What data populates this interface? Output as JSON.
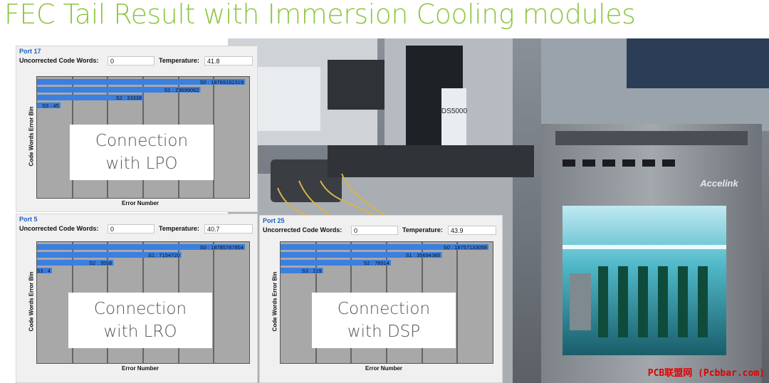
{
  "slide": {
    "title": "FEC Tail Result with Immersion Cooling modules"
  },
  "watermark": "PCB联盟网 (Pcbbar.com)",
  "photo": {
    "brand_text": "Accelink",
    "product_card_text": "DS5000"
  },
  "labels": {
    "uncorrected": "Uncorrected Code Words:",
    "temperature": "Temperature:",
    "y_axis": "Code Words Error Bin",
    "x_axis": "Error Number"
  },
  "panels": [
    {
      "port": "Port 17",
      "uncorrected_value": "0",
      "temperature_value": "41.8",
      "overlay_line1": "Connection",
      "overlay_line2": "with LPO",
      "bars": [
        {
          "label": "S0 : 18769192319",
          "frac": 0.98
        },
        {
          "label": "S1 : 23699062",
          "frac": 0.77
        },
        {
          "label": "S2 : 33338",
          "frac": 0.5
        },
        {
          "label": "S3 : 45",
          "frac": 0.11
        }
      ]
    },
    {
      "port": "Port 5",
      "uncorrected_value": "0",
      "temperature_value": "40.7",
      "overlay_line1": "Connection",
      "overlay_line2": "with LRO",
      "bars": [
        {
          "label": "S0 : 18785787854",
          "frac": 0.98
        },
        {
          "label": "S1 : 7154720",
          "frac": 0.68
        },
        {
          "label": "S2 : 3558",
          "frac": 0.36
        },
        {
          "label": "S3 : 4",
          "frac": 0.07
        }
      ]
    },
    {
      "port": "Port 25",
      "uncorrected_value": "0",
      "temperature_value": "43.9",
      "overlay_line1": "Connection",
      "overlay_line2": "with DSP",
      "bars": [
        {
          "label": "S0 : 18757133058",
          "frac": 0.98
        },
        {
          "label": "S1 : 35694385",
          "frac": 0.76
        },
        {
          "label": "S2 : 78914",
          "frac": 0.52
        },
        {
          "label": "S3 : 219",
          "frac": 0.2
        }
      ]
    }
  ],
  "colors": {
    "title": "#8cc63f",
    "bar": "#3b7fe0",
    "plot_bg": "#a8a8a8",
    "port": "#1f5fbf",
    "watermark": "#e00000"
  }
}
